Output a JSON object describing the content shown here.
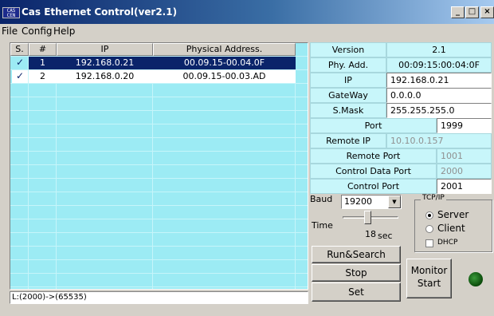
{
  "window": {
    "title": "Cas Ethernet Control(ver2.1)",
    "icon_text": "CAS CEN"
  },
  "menu": [
    "File",
    "Config",
    "Help"
  ],
  "table": {
    "columns": [
      "S.",
      "#",
      "IP",
      "Physical Address."
    ],
    "rows": [
      {
        "check": "✓",
        "num": "1",
        "ip": "192.168.0.21",
        "mac": "00.09.15-00.04.0F",
        "selected": true
      },
      {
        "check": "✓",
        "num": "2",
        "ip": "192.168.0.20",
        "mac": "00.09.15-00.03.AD",
        "selected": false
      }
    ]
  },
  "status": "L:(2000)->(65535)",
  "props": {
    "version_label": "Version",
    "version_value": "2.1",
    "phy_label": "Phy. Add.",
    "phy_value": "00:09:15:00:04:0F",
    "ip_label": "IP",
    "ip_value": "192.168.0.21",
    "gateway_label": "GateWay",
    "gateway_value": "0.0.0.0",
    "smask_label": "S.Mask",
    "smask_value": "255.255.255.0",
    "port_label": "Port",
    "port_value": "1999",
    "remote_ip_label": "Remote IP",
    "remote_ip_value": "10.10.0.157",
    "remote_port_label": "Remote Port",
    "remote_port_value": "1001",
    "control_data_port_label": "Control Data Port",
    "control_data_port_value": "2000",
    "control_port_label": "Control Port",
    "control_port_value": "2001"
  },
  "baud": {
    "label": "Baud",
    "value": "19200"
  },
  "time": {
    "label": "Time",
    "value": "18",
    "unit": "sec",
    "slider_fraction": 0.4
  },
  "tcpip": {
    "title": "TCP/IP",
    "server": "Server",
    "client": "Client",
    "dhcp": "DHCP",
    "selected": "Server",
    "dhcp_checked": false
  },
  "buttons": {
    "run_search": "Run&Search",
    "stop": "Stop",
    "set": "Set",
    "monitor_start_line1": "Monitor",
    "monitor_start_line2": "Start"
  },
  "colors": {
    "list_bg": "#9cebf4",
    "selection": "#0a246a",
    "led": "#0a5a0a"
  }
}
